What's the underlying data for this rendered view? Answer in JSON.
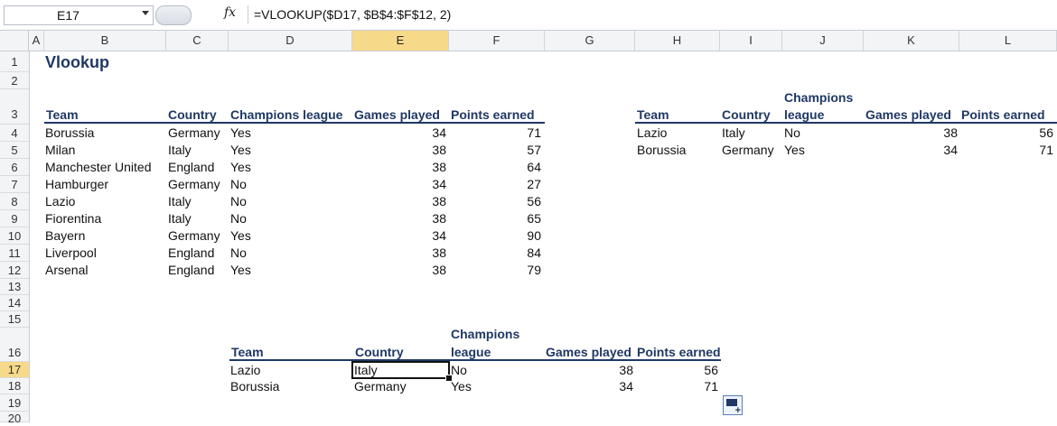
{
  "formula_bar": {
    "name_box": "E17",
    "fx_symbol": "fx",
    "formula": "=VLOOKUP($D17, $B$4:$F$12, 2)"
  },
  "columns": [
    "A",
    "B",
    "C",
    "D",
    "E",
    "F",
    "G",
    "H",
    "I",
    "J",
    "K",
    "L"
  ],
  "selected_column": "E",
  "rows": [
    "1",
    "2",
    "3",
    "4",
    "5",
    "6",
    "7",
    "8",
    "9",
    "10",
    "11",
    "12",
    "13",
    "14",
    "15",
    "16",
    "17",
    "18",
    "19",
    "20"
  ],
  "selected_row": "17",
  "title": "Vlookup",
  "main_table": {
    "headers": [
      "Team",
      "Country",
      "Champions league",
      "Games played",
      "Points earned"
    ],
    "rows": [
      [
        "Borussia",
        "Germany",
        "Yes",
        "34",
        "71"
      ],
      [
        "Milan",
        "Italy",
        "Yes",
        "38",
        "57"
      ],
      [
        "Manchester United",
        "England",
        "Yes",
        "38",
        "64"
      ],
      [
        "Hamburger",
        "Germany",
        "No",
        "34",
        "27"
      ],
      [
        "Lazio",
        "Italy",
        "No",
        "38",
        "56"
      ],
      [
        "Fiorentina",
        "Italy",
        "No",
        "38",
        "65"
      ],
      [
        "Bayern",
        "Germany",
        "Yes",
        "34",
        "90"
      ],
      [
        "Liverpool",
        "England",
        "No",
        "38",
        "84"
      ],
      [
        "Arsenal",
        "England",
        "Yes",
        "38",
        "79"
      ]
    ]
  },
  "right_table": {
    "headers": [
      "Team",
      "Country",
      "Champions",
      "league",
      "Games played",
      "Points earned"
    ],
    "rows": [
      [
        "Lazio",
        "Italy",
        "No",
        "38",
        "56"
      ],
      [
        "Borussia",
        "Germany",
        "Yes",
        "34",
        "71"
      ]
    ]
  },
  "bottom_table": {
    "headers": [
      "Team",
      "Country",
      "Champions",
      "league",
      "Games played",
      "Points earned"
    ],
    "rows": [
      [
        "Lazio",
        "Italy",
        "No",
        "38",
        "56"
      ],
      [
        "Borussia",
        "Germany",
        "Yes",
        "34",
        "71"
      ]
    ]
  },
  "colors": {
    "header_text": "#1f3864",
    "selection": "#f7d98a"
  }
}
